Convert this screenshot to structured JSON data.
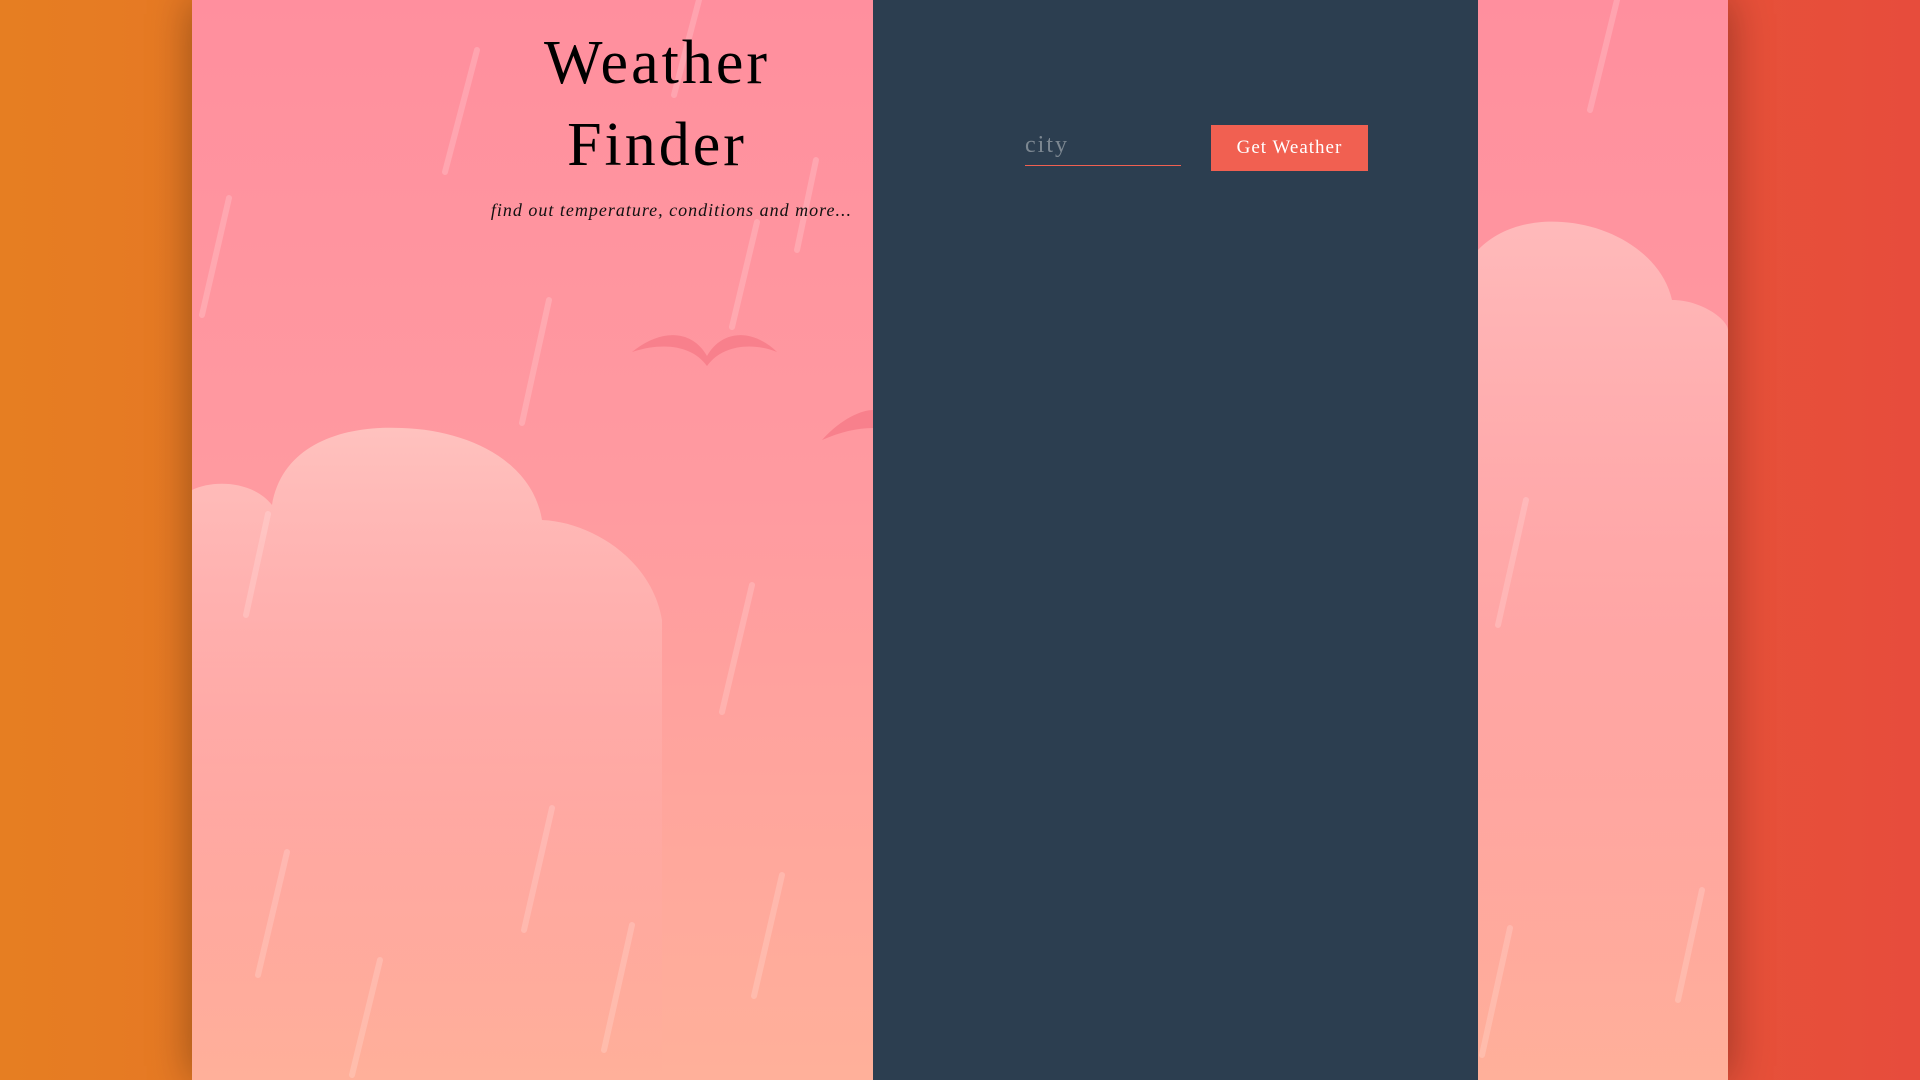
{
  "header": {
    "title_line1": "Weather",
    "title_line2": "Finder",
    "subtitle": "find out temperature, conditions and more..."
  },
  "form": {
    "city_placeholder": "city",
    "city_value": "",
    "submit_label": "Get Weather"
  },
  "colors": {
    "page_bg_left": "#e67e22",
    "page_bg_right": "#e74c3c",
    "form_panel_bg": "#2c3e50",
    "accent": "#f16051",
    "sky_top": "#ff8f9e",
    "sky_bottom": "#ffb09a"
  }
}
